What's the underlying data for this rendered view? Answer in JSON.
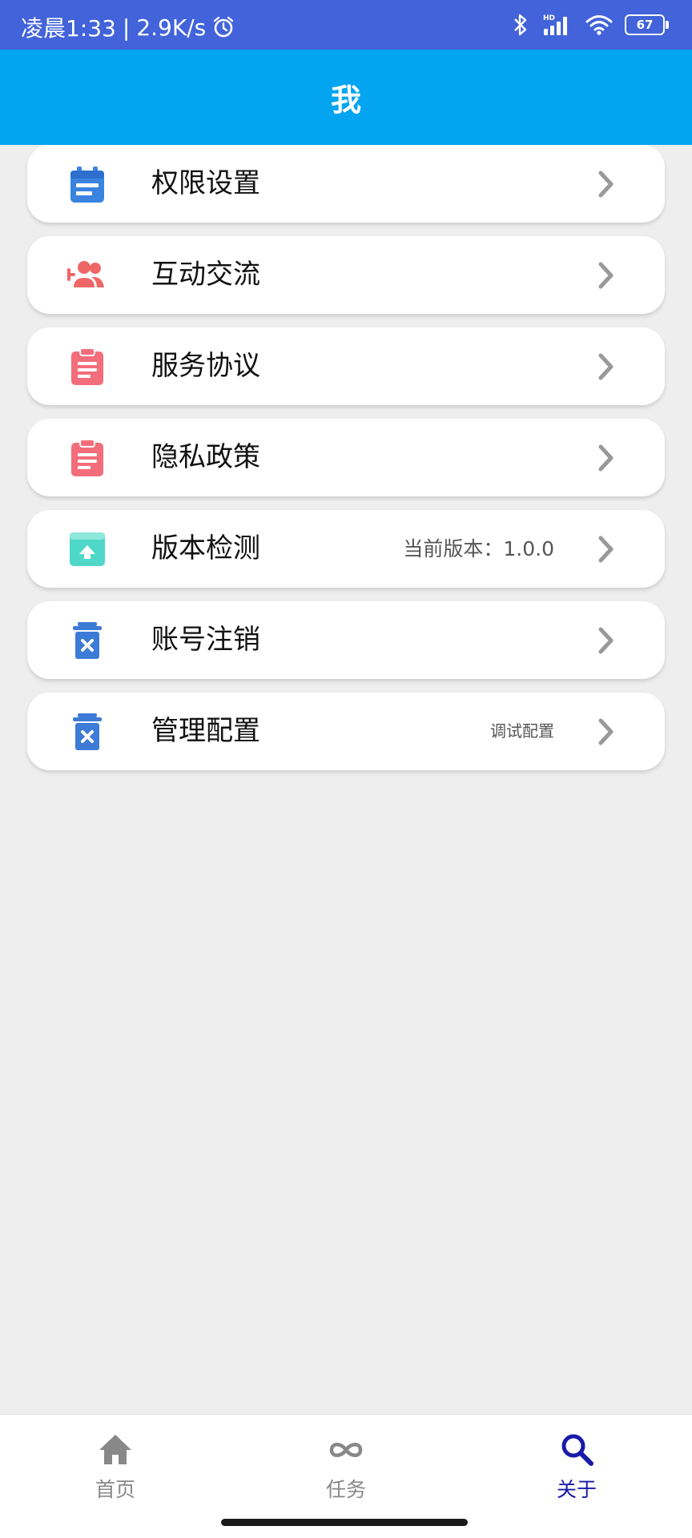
{
  "status_bar": {
    "time": "凌晨1:33",
    "separator": "|",
    "net_speed": "2.9K/s",
    "battery": "67",
    "network_badge": "HD",
    "icons": [
      "alarm-icon",
      "bluetooth-icon",
      "signal-icon",
      "wifi-icon",
      "battery-icon"
    ]
  },
  "header": {
    "title": "我"
  },
  "menu": {
    "items": [
      {
        "label": "权限设置",
        "extra": "",
        "icon": "calendar-icon",
        "icon_color": "#3a84e0"
      },
      {
        "label": "互动交流",
        "extra": "",
        "icon": "add-group-icon",
        "icon_color": "#ef6666"
      },
      {
        "label": "服务协议",
        "extra": "",
        "icon": "clipboard-icon",
        "icon_color": "#f36d7a"
      },
      {
        "label": "隐私政策",
        "extra": "",
        "icon": "clipboard-icon",
        "icon_color": "#f36d7a"
      },
      {
        "label": "版本检测",
        "extra": "当前版本：1.0.0",
        "icon": "upload-folder-icon",
        "icon_color": "#4fd8c8"
      },
      {
        "label": "账号注销",
        "extra": "",
        "icon": "delete-icon",
        "icon_color": "#3d7bd6"
      },
      {
        "label": "管理配置",
        "extra": "调试配置",
        "icon": "delete-icon",
        "icon_color": "#3d7bd6"
      }
    ]
  },
  "bottom_nav": {
    "items": [
      {
        "label": "首页",
        "icon": "home-icon",
        "active": false
      },
      {
        "label": "任务",
        "icon": "infinity-icon",
        "active": false
      },
      {
        "label": "关于",
        "icon": "search-icon",
        "active": true
      }
    ],
    "active_color": "#1a1aa8",
    "inactive_color": "#888888"
  },
  "colors": {
    "status_bar": "#4263d9",
    "app_bar": "#03a5f0",
    "background": "#eeeeee",
    "chevron": "#999999"
  }
}
